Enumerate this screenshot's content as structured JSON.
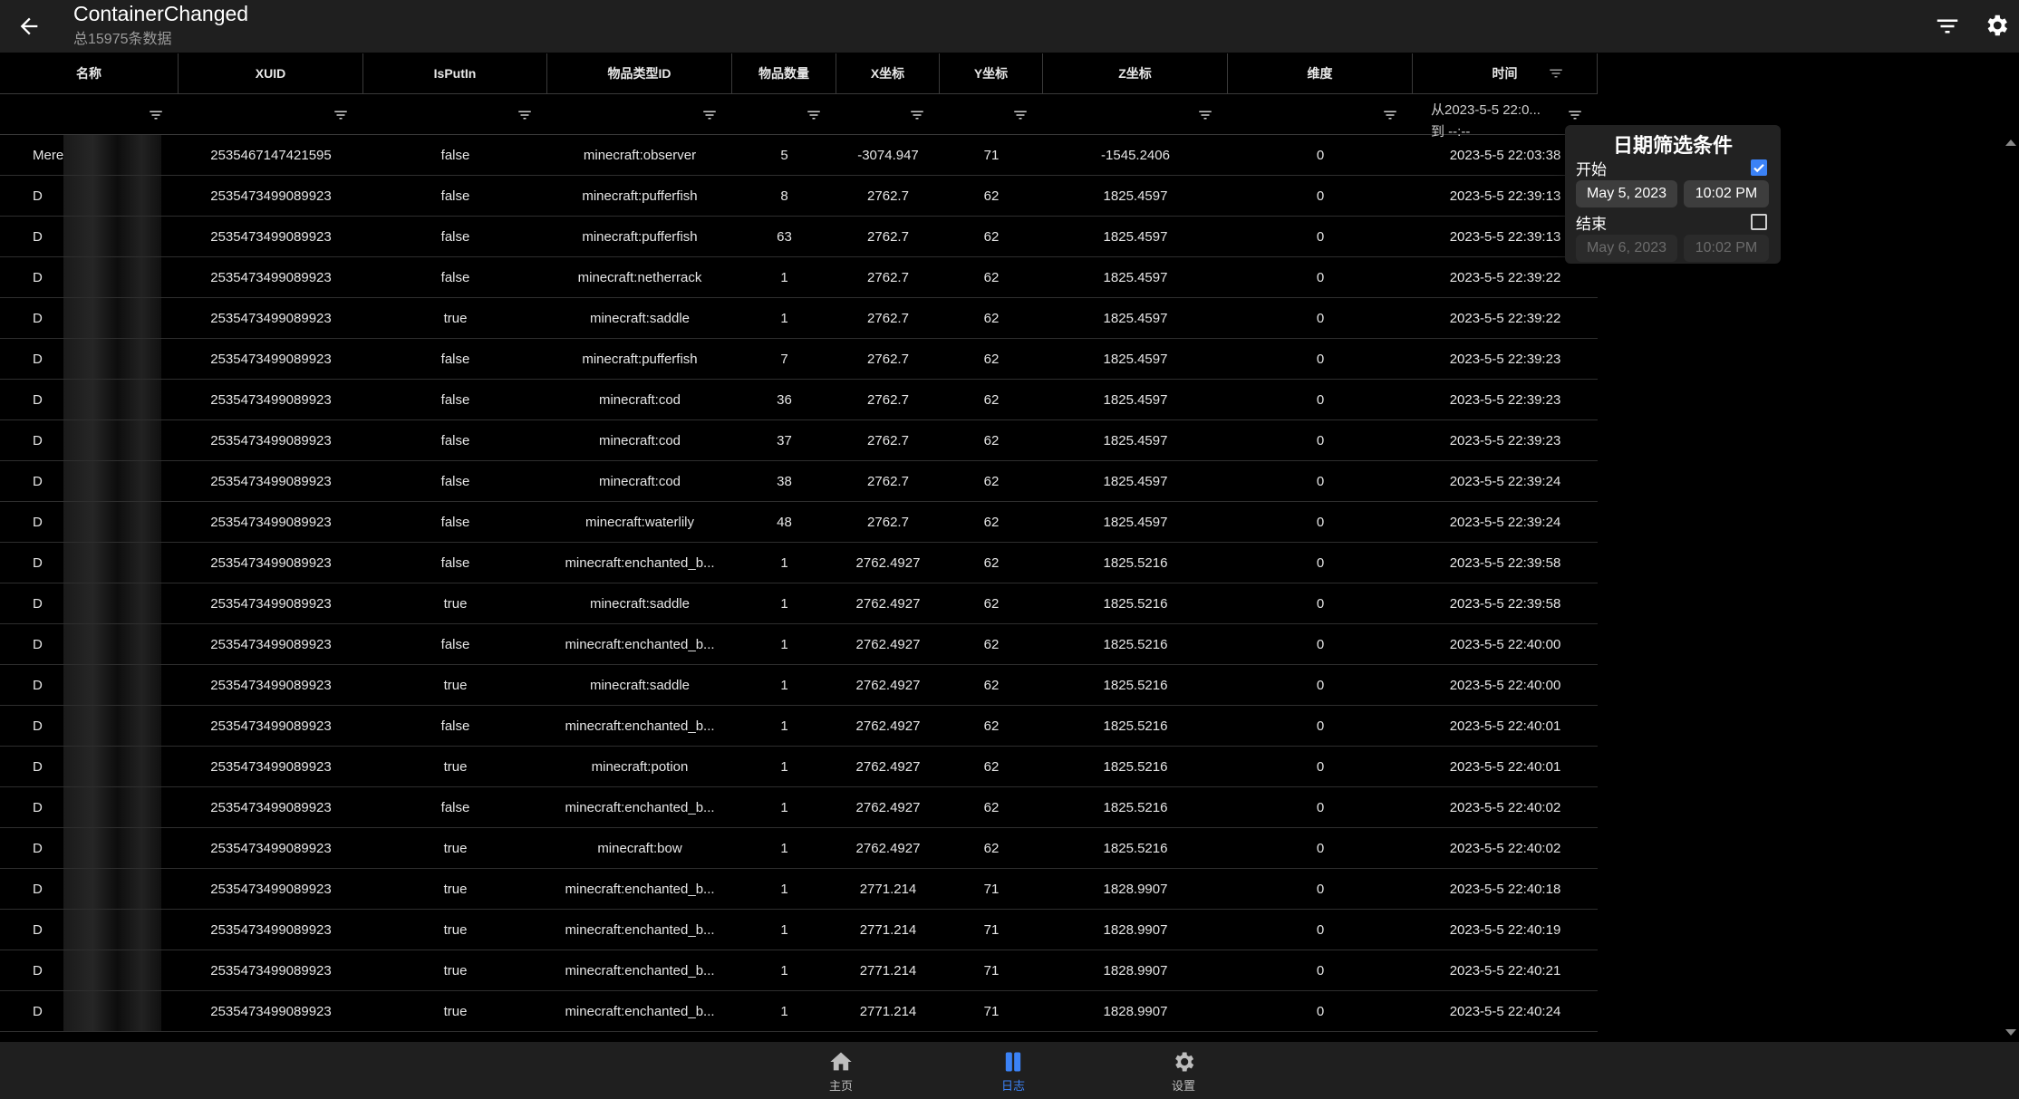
{
  "appbar": {
    "title": "ContainerChanged",
    "subtitle": "总15975条数据"
  },
  "table": {
    "columns": [
      "名称",
      "XUID",
      "IsPutIn",
      "物品类型ID",
      "物品数量",
      "X坐标",
      "Y坐标",
      "Z坐标",
      "维度",
      "时间"
    ],
    "time_filter_line1": "从2023-5-5 22:0...",
    "time_filter_line2": "到 --:--",
    "rows": [
      [
        "Mere",
        "2535467147421595",
        "false",
        "minecraft:observer",
        "5",
        "-3074.947",
        "71",
        "-1545.2406",
        "0",
        "2023-5-5 22:03:38"
      ],
      [
        "D",
        "2535473499089923",
        "false",
        "minecraft:pufferfish",
        "8",
        "2762.7",
        "62",
        "1825.4597",
        "0",
        "2023-5-5 22:39:13"
      ],
      [
        "D",
        "2535473499089923",
        "false",
        "minecraft:pufferfish",
        "63",
        "2762.7",
        "62",
        "1825.4597",
        "0",
        "2023-5-5 22:39:13"
      ],
      [
        "D",
        "2535473499089923",
        "false",
        "minecraft:netherrack",
        "1",
        "2762.7",
        "62",
        "1825.4597",
        "0",
        "2023-5-5 22:39:22"
      ],
      [
        "D",
        "2535473499089923",
        "true",
        "minecraft:saddle",
        "1",
        "2762.7",
        "62",
        "1825.4597",
        "0",
        "2023-5-5 22:39:22"
      ],
      [
        "D",
        "2535473499089923",
        "false",
        "minecraft:pufferfish",
        "7",
        "2762.7",
        "62",
        "1825.4597",
        "0",
        "2023-5-5 22:39:23"
      ],
      [
        "D",
        "2535473499089923",
        "false",
        "minecraft:cod",
        "36",
        "2762.7",
        "62",
        "1825.4597",
        "0",
        "2023-5-5 22:39:23"
      ],
      [
        "D",
        "2535473499089923",
        "false",
        "minecraft:cod",
        "37",
        "2762.7",
        "62",
        "1825.4597",
        "0",
        "2023-5-5 22:39:23"
      ],
      [
        "D",
        "2535473499089923",
        "false",
        "minecraft:cod",
        "38",
        "2762.7",
        "62",
        "1825.4597",
        "0",
        "2023-5-5 22:39:24"
      ],
      [
        "D",
        "2535473499089923",
        "false",
        "minecraft:waterlily",
        "48",
        "2762.7",
        "62",
        "1825.4597",
        "0",
        "2023-5-5 22:39:24"
      ],
      [
        "D",
        "2535473499089923",
        "false",
        "minecraft:enchanted_b...",
        "1",
        "2762.4927",
        "62",
        "1825.5216",
        "0",
        "2023-5-5 22:39:58"
      ],
      [
        "D",
        "2535473499089923",
        "true",
        "minecraft:saddle",
        "1",
        "2762.4927",
        "62",
        "1825.5216",
        "0",
        "2023-5-5 22:39:58"
      ],
      [
        "D",
        "2535473499089923",
        "false",
        "minecraft:enchanted_b...",
        "1",
        "2762.4927",
        "62",
        "1825.5216",
        "0",
        "2023-5-5 22:40:00"
      ],
      [
        "D",
        "2535473499089923",
        "true",
        "minecraft:saddle",
        "1",
        "2762.4927",
        "62",
        "1825.5216",
        "0",
        "2023-5-5 22:40:00"
      ],
      [
        "D",
        "2535473499089923",
        "false",
        "minecraft:enchanted_b...",
        "1",
        "2762.4927",
        "62",
        "1825.5216",
        "0",
        "2023-5-5 22:40:01"
      ],
      [
        "D",
        "2535473499089923",
        "true",
        "minecraft:potion",
        "1",
        "2762.4927",
        "62",
        "1825.5216",
        "0",
        "2023-5-5 22:40:01"
      ],
      [
        "D",
        "2535473499089923",
        "false",
        "minecraft:enchanted_b...",
        "1",
        "2762.4927",
        "62",
        "1825.5216",
        "0",
        "2023-5-5 22:40:02"
      ],
      [
        "D",
        "2535473499089923",
        "true",
        "minecraft:bow",
        "1",
        "2762.4927",
        "62",
        "1825.5216",
        "0",
        "2023-5-5 22:40:02"
      ],
      [
        "D",
        "2535473499089923",
        "true",
        "minecraft:enchanted_b...",
        "1",
        "2771.214",
        "71",
        "1828.9907",
        "0",
        "2023-5-5 22:40:18"
      ],
      [
        "D",
        "2535473499089923",
        "true",
        "minecraft:enchanted_b...",
        "1",
        "2771.214",
        "71",
        "1828.9907",
        "0",
        "2023-5-5 22:40:19"
      ],
      [
        "D",
        "2535473499089923",
        "true",
        "minecraft:enchanted_b...",
        "1",
        "2771.214",
        "71",
        "1828.9907",
        "0",
        "2023-5-5 22:40:21"
      ],
      [
        "D",
        "2535473499089923",
        "true",
        "minecraft:enchanted_b...",
        "1",
        "2771.214",
        "71",
        "1828.9907",
        "0",
        "2023-5-5 22:40:24"
      ]
    ]
  },
  "date_filter": {
    "title": "日期筛选条件",
    "start_label": "开始",
    "start_checked": true,
    "start_date": "May 5, 2023",
    "start_time": "10:02 PM",
    "end_label": "结束",
    "end_checked": false,
    "end_date": "May 6, 2023",
    "end_time": "10:02 PM"
  },
  "bottom_nav": [
    {
      "label": "主页",
      "icon": "home-icon",
      "active": false
    },
    {
      "label": "日志",
      "icon": "log-icon",
      "active": true
    },
    {
      "label": "设置",
      "icon": "gear-icon",
      "active": false
    }
  ],
  "colors": {
    "accent": "#3b82f6",
    "background": "#000000",
    "bar": "#1f1f1f"
  }
}
